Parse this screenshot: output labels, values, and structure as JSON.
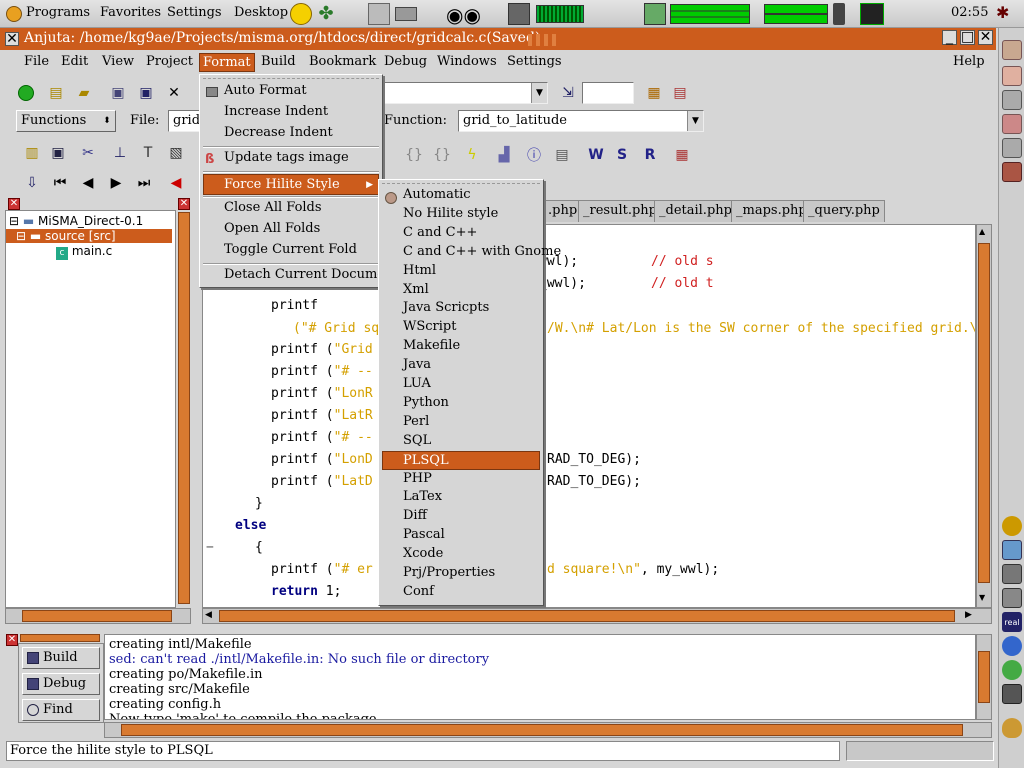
{
  "panel": {
    "programs": "Programs",
    "favorites": "Favorites",
    "settings": "Settings",
    "desktop": "Desktop",
    "clock": "02:55"
  },
  "window": {
    "title": "Anjuta: /home/kg9ae/Projects/misma.org/htdocs/direct/gridcalc.c(Saved)"
  },
  "menubar": [
    "File",
    "Edit",
    "View",
    "Project",
    "Format",
    "Build",
    "Bookmark",
    "Debug",
    "Windows",
    "Settings",
    "Help"
  ],
  "toolbar2": {
    "functions_label": "Functions",
    "file_label": "File:",
    "file_value": "grid",
    "function_label": "Function:",
    "function_value": "grid_to_latitude"
  },
  "tree": {
    "root": "MiSMA_Direct-0.1",
    "source": "source [src]",
    "file": "main.c"
  },
  "tabs": [
    ".php",
    "_result.php",
    "_detail.php",
    "_maps.php",
    "_query.php"
  ],
  "format_menu": {
    "items": [
      "Auto Format",
      "Increase Indent",
      "Decrease Indent",
      "Update tags image",
      "Force Hilite Style",
      "Close All Folds",
      "Open All Folds",
      "Toggle Current Fold",
      "Detach Current Document"
    ]
  },
  "hilite_menu": {
    "items": [
      "Automatic",
      "No Hilite style",
      "C and C++",
      "C and C++ with Gnome",
      "Html",
      "Xml",
      "Java Scricpts",
      "WScript",
      "Makefile",
      "Java",
      "LUA",
      "Python",
      "Perl",
      "SQL",
      "PLSQL",
      "PHP",
      "LaTex",
      "Diff",
      "Pascal",
      "Xcode",
      "Prj/Properties",
      "Conf"
    ],
    "selected": "PLSQL"
  },
  "code": {
    "l1a": "wwl);",
    "l1c": "// old s",
    "l2a": "_wwl);",
    "l2c": "// old t",
    "l3": "printf",
    "l4a": "(\"# Grid squ",
    "l4b": "/W.\\n# Lat/Lon is the SW corner of the specified grid.\\n\");",
    "printf_lines": [
      {
        "a": "printf (",
        "s": "\"Grid",
        "b": ""
      },
      {
        "a": "printf (",
        "s": "\"# --",
        "b": ""
      },
      {
        "a": "printf (",
        "s": "\"LonR",
        "b": ""
      },
      {
        "a": "printf (",
        "s": "\"LatR",
        "b": ""
      },
      {
        "a": "printf (",
        "s": "\"# --",
        "b": ""
      },
      {
        "a": "printf (",
        "s": "\"LonD",
        "b": "RAD_TO_DEG);"
      },
      {
        "a": "printf (",
        "s": "\"LatD",
        "b": "RAD_TO_DEG);"
      }
    ],
    "close_brace": "}",
    "else": "else",
    "open_brace": "{",
    "err_a": "printf (",
    "err_s": "\"# er",
    "err_s2": "d square!\\n\"",
    "err_b": ", my_wwl);",
    "ret": "return",
    "ret_val": " 1;"
  },
  "bottom": {
    "build": "Build",
    "debug": "Debug",
    "find": "Find",
    "lines": [
      {
        "text": "creating intl/Makefile",
        "color": "#000000"
      },
      {
        "text": "sed: can't read ./intl/Makefile.in: No such file or directory",
        "color": "#1a1aa0"
      },
      {
        "text": "creating po/Makefile.in",
        "color": "#000000"
      },
      {
        "text": "creating src/Makefile",
        "color": "#000000"
      },
      {
        "text": "creating config.h",
        "color": "#000000"
      },
      {
        "text": "Now type 'make' to compile the package.",
        "color": "#000000"
      }
    ]
  },
  "status": "Force the hilite style to PLSQL",
  "colors": {
    "accent": "#cc5c1c"
  }
}
